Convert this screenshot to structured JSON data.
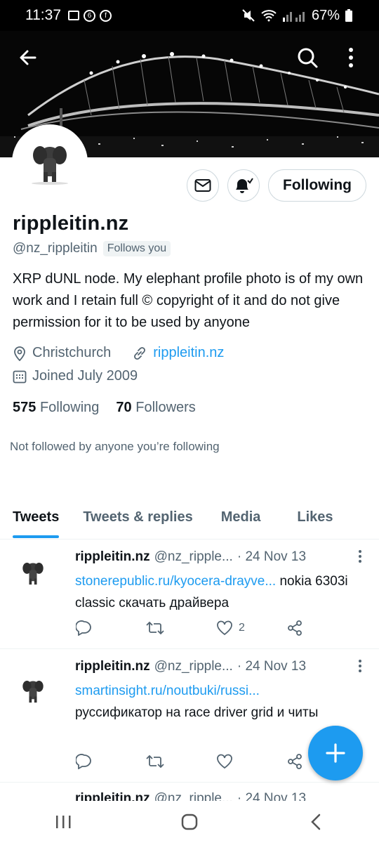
{
  "status_bar": {
    "time": "11:37",
    "battery": "67%"
  },
  "header": {
    "back_icon": "arrow-left-icon",
    "search_icon": "search-icon",
    "more_icon": "more-vertical-icon"
  },
  "profile": {
    "name": "rippleitin.nz",
    "handle": "@nz_rippleitin",
    "follows_you": "Follows you",
    "bio": "XRP dUNL node. My elephant profile photo is of my own work and I retain full © copyright of it and do not give permission for it to be used by anyone",
    "location": "Christchurch",
    "website": "rippleitin.nz",
    "joined": "Joined July 2009",
    "following_count": "575",
    "following_label": "Following",
    "followers_count": "70",
    "followers_label": "Followers",
    "not_followed": "Not followed by anyone you’re following",
    "follow_button": "Following"
  },
  "tabs": [
    {
      "label": "Tweets",
      "active": true
    },
    {
      "label": "Tweets & replies",
      "active": false
    },
    {
      "label": "Media",
      "active": false
    },
    {
      "label": "Likes",
      "active": false
    }
  ],
  "tweets": [
    {
      "name": "rippleitin.nz",
      "handle": "@nz_ripple...",
      "date": "· 24 Nov 13",
      "link": "stonerepublic.ru/kyocera-drayve...",
      "text_after_link": " nokia 6303i classic скачать драйвера",
      "text_block": "",
      "likes": "2"
    },
    {
      "name": "rippleitin.nz",
      "handle": "@nz_ripple...",
      "date": "· 24 Nov 13",
      "link": "smartinsight.ru/noutbuki/russi...",
      "text_after_link": "",
      "text_block": "руссификатор на race driver grid и читы",
      "likes": ""
    }
  ],
  "partial_tweet": {
    "name": "rippleitin.nz",
    "handle": "@nz_ripple...",
    "date": "· 24 Nov 13"
  },
  "colors": {
    "accent": "#1d9bf0",
    "text": "#0f1419",
    "secondary": "#536471"
  }
}
